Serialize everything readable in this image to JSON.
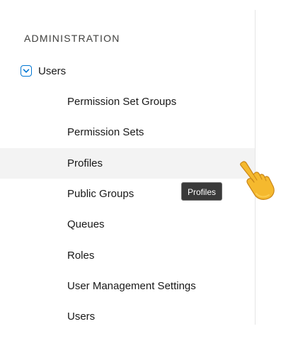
{
  "sidebar": {
    "section_title": "ADMINISTRATION",
    "parent": {
      "label": "Users",
      "expanded": true,
      "chevron_icon": "chevron-down-icon",
      "chevron_color": "#0176d3"
    },
    "items": [
      {
        "label": "Permission Set Groups"
      },
      {
        "label": "Permission Sets"
      },
      {
        "label": "Profiles"
      },
      {
        "label": "Public Groups"
      },
      {
        "label": "Queues"
      },
      {
        "label": "Roles"
      },
      {
        "label": "User Management Settings"
      },
      {
        "label": "Users"
      }
    ],
    "hovered_item": "Profiles"
  },
  "tooltip": {
    "text": "Profiles"
  },
  "cursor": {
    "icon": "pointing-hand-cursor-icon"
  }
}
